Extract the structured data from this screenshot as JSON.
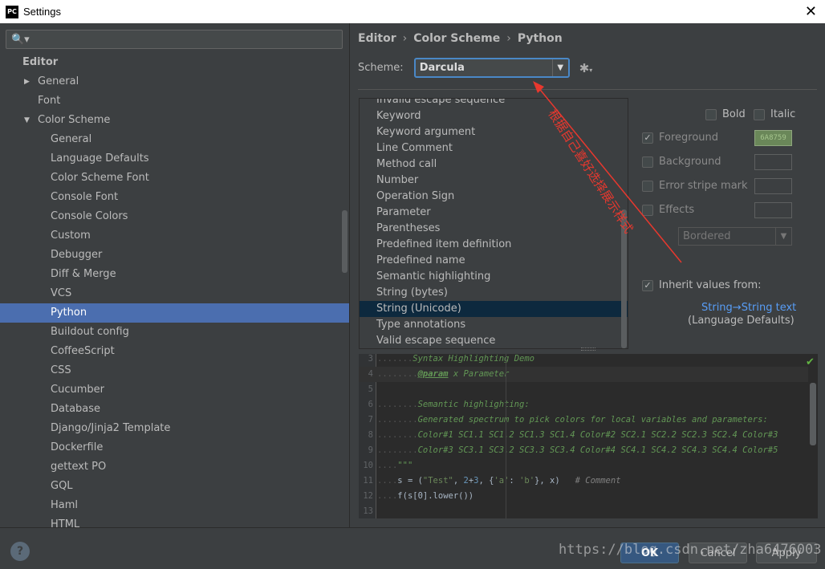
{
  "window": {
    "title": "Settings",
    "app_icon": "PC",
    "close_glyph": "✕"
  },
  "search": {
    "icon": "🔍▾",
    "value": "",
    "placeholder": ""
  },
  "tree": {
    "root": "Editor",
    "general": "General",
    "font": "Font",
    "color_scheme": "Color Scheme",
    "children": [
      "General",
      "Language Defaults",
      "Color Scheme Font",
      "Console Font",
      "Console Colors",
      "Custom",
      "Debugger",
      "Diff & Merge",
      "VCS",
      "Python",
      "Buildout config",
      "CoffeeScript",
      "CSS",
      "Cucumber",
      "Database",
      "Django/Jinja2 Template",
      "Dockerfile",
      "gettext PO",
      "GQL",
      "Haml",
      "HTML"
    ],
    "selected": "Python"
  },
  "breadcrumb": [
    "Editor",
    "Color Scheme",
    "Python"
  ],
  "scheme": {
    "label": "Scheme:",
    "value": "Darcula"
  },
  "elements": [
    "Invalid escape sequence",
    "Keyword",
    "Keyword argument",
    "Line Comment",
    "Method call",
    "Number",
    "Operation Sign",
    "Parameter",
    "Parentheses",
    "Predefined item definition",
    "Predefined name",
    "Semantic highlighting",
    "String (bytes)",
    "String (Unicode)",
    "Type annotations",
    "Valid escape sequence"
  ],
  "selected_element": "String (Unicode)",
  "attributes": {
    "bold": "Bold",
    "italic": "Italic",
    "foreground": "Foreground",
    "foreground_color": "6A8759",
    "background": "Background",
    "error_stripe": "Error stripe mark",
    "effects": "Effects",
    "effects_type": "Bordered",
    "inherit": "Inherit values from:",
    "inherit_link": "String→String text",
    "inherit_sub": "(Language Defaults)"
  },
  "annotation": "根据自己喜好选择展示样式",
  "code": {
    "l3_no": "3",
    "l3": "Syntax Highlighting Demo",
    "l4_no": "4",
    "l4_tag": "@param",
    "l4_rest": " x Parameter",
    "l5_no": "5",
    "l6_no": "6",
    "l6": "Semantic highlighting:",
    "l7_no": "7",
    "l7": "Generated spectrum to pick colors for local variables and parameters:",
    "l8_no": "8",
    "l8": "Color#1 SC1.1 SC1.2 SC1.3 SC1.4 Color#2 SC2.1 SC2.2 SC2.3 SC2.4 Color#3",
    "l9_no": "9",
    "l9": "Color#3 SC3.1 SC3.2 SC3.3 SC3.4 Color#4 SC4.1 SC4.2 SC4.3 SC4.4 Color#5",
    "l10_no": "10",
    "l10": "\"\"\"",
    "l11_no": "11",
    "l11_a": "s = (",
    "l11_str": "\"Test\"",
    "l11_b": ", ",
    "l11_num": "2",
    "l11_c": "+",
    "l11_num2": "3",
    "l11_d": ", {",
    "l11_s2": "'a'",
    "l11_e": ": ",
    "l11_s3": "'b'",
    "l11_f": "}, x)   ",
    "l11_cmt": "# Comment",
    "l12_no": "12",
    "l12": "f(s[0].lower())",
    "l13_no": "13"
  },
  "buttons": {
    "help": "?",
    "ok": "OK",
    "cancel": "Cancel",
    "apply": "Apply"
  },
  "watermark": "https://blog.csdn.net/zha6476003",
  "colors": {
    "accent": "#4b6eaf",
    "annotation": "#e8382e",
    "link": "#589df6"
  }
}
